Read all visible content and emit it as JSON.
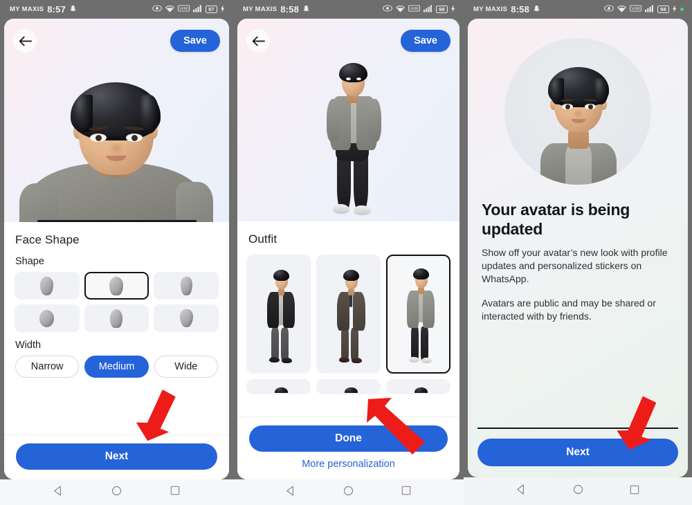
{
  "screens": [
    {
      "id": "face-shape",
      "status": {
        "carrier": "MY MAXIS",
        "time": "8:57",
        "battery": "97",
        "icons": [
          "eye-icon",
          "wifi-icon",
          "vowifi-icon",
          "signal-icon",
          "battery-icon",
          "charging-icon"
        ]
      },
      "topbar": {
        "back": "←",
        "save_label": "Save"
      },
      "sheet": {
        "title": "Face Shape",
        "shape_label": "Shape",
        "shape_options": [
          "shape-1",
          "shape-2",
          "shape-3",
          "shape-4",
          "shape-5",
          "shape-6"
        ],
        "shape_selected_index": 1,
        "width_label": "Width",
        "width_options": [
          "Narrow",
          "Medium",
          "Wide"
        ],
        "width_selected": "Medium",
        "cta_label": "Next"
      }
    },
    {
      "id": "outfit",
      "status": {
        "carrier": "MY MAXIS",
        "time": "8:58",
        "battery": "98",
        "icons": [
          "eye-icon",
          "wifi-icon",
          "vowifi-icon",
          "signal-icon",
          "battery-icon",
          "charging-icon"
        ]
      },
      "topbar": {
        "back": "←",
        "save_label": "Save"
      },
      "sheet": {
        "title": "Outfit",
        "outfit_options": [
          "outfit-black-jacket",
          "outfit-brown-suit",
          "outfit-gray-blazer"
        ],
        "outfit_selected_index": 2,
        "cta_label": "Done",
        "link_label": "More personalization"
      }
    },
    {
      "id": "avatar-updated",
      "status": {
        "carrier": "MY MAXIS",
        "time": "8:58",
        "battery": "98",
        "icons": [
          "eye-icon",
          "wifi-icon",
          "vowifi-icon",
          "signal-icon",
          "battery-icon",
          "charging-icon",
          "green-dot"
        ]
      },
      "title": "Your avatar is being updated",
      "paragraph_1": "Show off your avatar’s new look with profile updates and personalized stickers on WhatsApp.",
      "paragraph_2": "Avatars are public and may be shared or interacted with by friends.",
      "cta_label": "Next"
    }
  ],
  "navbar": {
    "back": "back-triangle",
    "home": "home-circle",
    "recents": "recents-square"
  },
  "colors": {
    "accent_blue": "#2563d9",
    "arrow_red": "#ee1c18",
    "status_gray": "#6e6e6e",
    "sheet_bg": "#ffffff",
    "chip_bg": "#f0f2f5",
    "selected_border": "#111111"
  }
}
